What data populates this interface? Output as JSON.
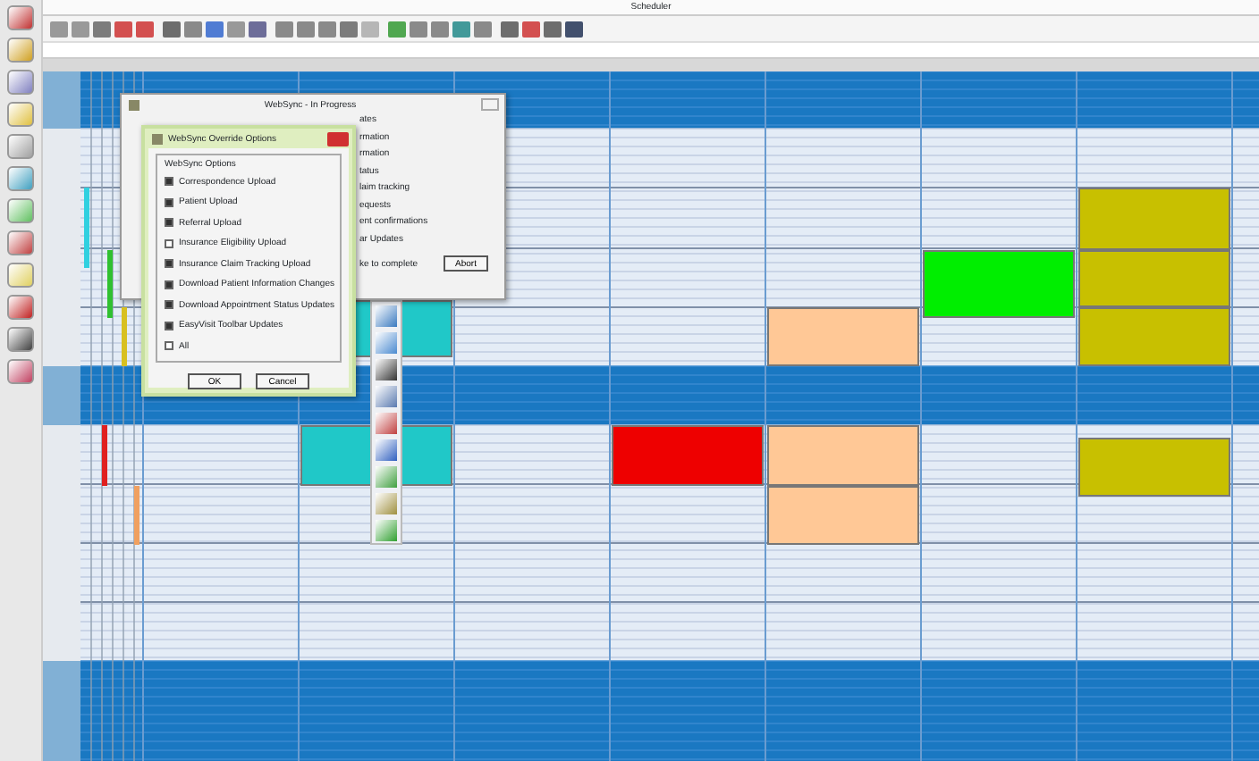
{
  "window": {
    "title": "Scheduler"
  },
  "markers": [
    {
      "color": "#30d0e0"
    },
    {
      "color": "#30c030"
    },
    {
      "color": "#d8c020"
    },
    {
      "color": "#e02020"
    },
    {
      "color": "#f0a060"
    }
  ],
  "appointments": [
    {
      "color": "#c8c000"
    },
    {
      "color": "#c8c000"
    },
    {
      "color": "#c8c000"
    },
    {
      "color": "#c8c000"
    },
    {
      "color": "#00ee00"
    },
    {
      "color": "#ffc896"
    },
    {
      "color": "#ffc896"
    },
    {
      "color": "#ffc896"
    },
    {
      "color": "#ee0000"
    },
    {
      "color": "#20c8c8"
    },
    {
      "color": "#20c8c8"
    }
  ],
  "progress_dialog": {
    "title": "WebSync - In Progress",
    "lines": [
      "ates",
      "rmation",
      "rmation",
      "tatus",
      "laim tracking",
      "equests",
      "ent confirmations",
      "ar Updates"
    ],
    "note": "ke to complete",
    "button": "Abort"
  },
  "override_dialog": {
    "title": "WebSync Override Options",
    "group": "WebSync Options",
    "options": [
      {
        "label": "Correspondence Upload",
        "checked": true
      },
      {
        "label": "Patient Upload",
        "checked": true
      },
      {
        "label": "Referral Upload",
        "checked": true
      },
      {
        "label": "Insurance Eligibility Upload",
        "checked": false
      },
      {
        "label": "Insurance Claim Tracking Upload",
        "checked": true
      },
      {
        "label": "Download Patient Information Changes",
        "checked": true
      },
      {
        "label": "Download Appointment Status Updates",
        "checked": true
      },
      {
        "label": "EasyVisit Toolbar Updates",
        "checked": true
      },
      {
        "label": "All",
        "checked": false
      }
    ],
    "buttons": [
      "OK",
      "Cancel"
    ]
  }
}
